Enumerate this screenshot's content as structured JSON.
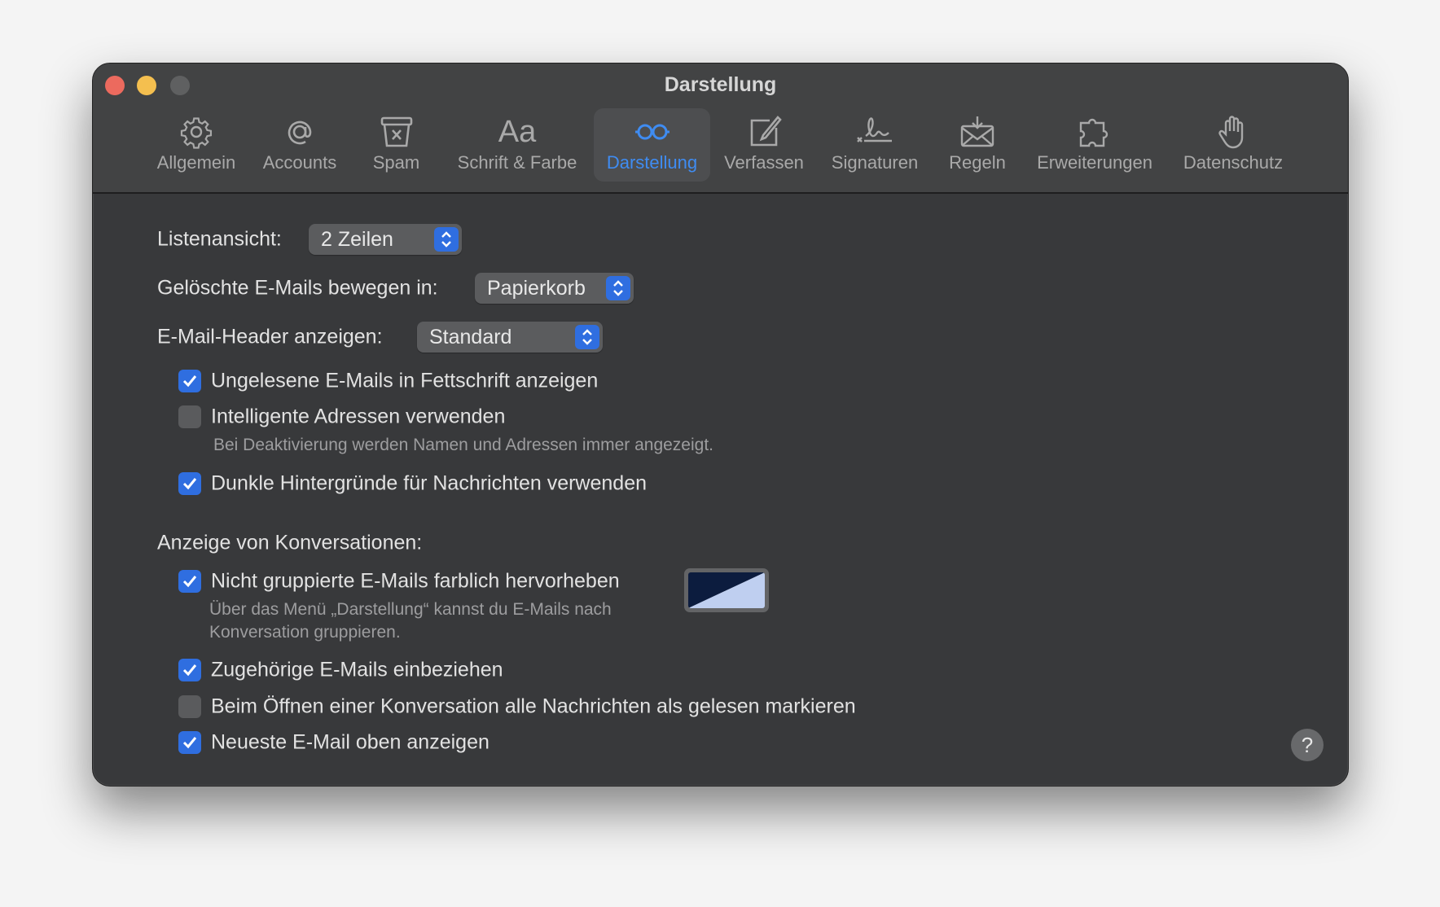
{
  "window": {
    "title": "Darstellung"
  },
  "toolbar": [
    {
      "label": "Allgemein",
      "icon": "gear-icon"
    },
    {
      "label": "Accounts",
      "icon": "at-icon"
    },
    {
      "label": "Spam",
      "icon": "junk-bin-icon"
    },
    {
      "label": "Schrift & Farbe",
      "icon": "font-icon",
      "glyph": "Aa"
    },
    {
      "label": "Darstellung",
      "icon": "glasses-icon",
      "selected": true
    },
    {
      "label": "Verfassen",
      "icon": "compose-icon"
    },
    {
      "label": "Signaturen",
      "icon": "signature-icon"
    },
    {
      "label": "Regeln",
      "icon": "rules-envelope-icon"
    },
    {
      "label": "Erweiterungen",
      "icon": "puzzle-icon"
    },
    {
      "label": "Datenschutz",
      "icon": "hand-icon"
    }
  ],
  "settings": {
    "list_view": {
      "label": "Listenansicht:",
      "value": "2 Zeilen"
    },
    "move_deleted": {
      "label": "Gelöschte E-Mails bewegen in:",
      "value": "Papierkorb"
    },
    "header": {
      "label": "E-Mail-Header anzeigen:",
      "value": "Standard"
    },
    "unread_bold": {
      "label": "Ungelesene E-Mails in Fettschrift anzeigen",
      "checked": true
    },
    "smart_addresses": {
      "label": "Intelligente Adressen verwenden",
      "checked": false,
      "hint": "Bei Deaktivierung werden Namen und Adressen immer angezeigt."
    },
    "dark_bg": {
      "label": "Dunkle Hintergründe für Nachrichten verwenden",
      "checked": true
    },
    "conversations_heading": "Anzeige von Konversationen:",
    "highlight": {
      "label": "Nicht gruppierte E-Mails farblich hervorheben",
      "checked": true,
      "hint1": "Über das Menü „Darstellung“ kannst du E-Mails nach",
      "hint2": "Konversation gruppieren.",
      "color_dark": "#0c1c3e",
      "color_light": "#bfcff0"
    },
    "related": {
      "label": "Zugehörige E-Mails einbeziehen",
      "checked": true
    },
    "mark_read": {
      "label": "Beim Öffnen einer Konversation alle Nachrichten als gelesen markieren",
      "checked": false
    },
    "newest_top": {
      "label": "Neueste E-Mail oben anzeigen",
      "checked": true
    }
  },
  "help": {
    "label": "?"
  },
  "colors": {
    "accent": "#3f8cf2",
    "checkbox": "#2f6ee0"
  }
}
